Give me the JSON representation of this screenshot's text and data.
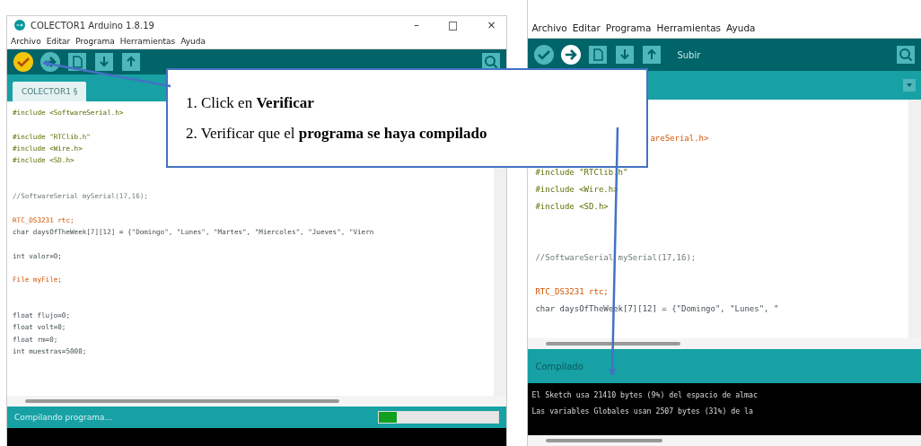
{
  "callout": {
    "steps": [
      "1. Click en **Verificar**",
      "2. Verificar que el **programa se haya compilado**"
    ]
  },
  "left_window": {
    "title": "COLECTOR1 Arduino 1.8.19",
    "window_controls": [
      "–",
      "□",
      "×"
    ],
    "menu": [
      "Archivo",
      "Editar",
      "Programa",
      "Herramientas",
      "Ayuda"
    ],
    "toolbar": [
      {
        "kind": "verify",
        "highlighted": true
      },
      {
        "kind": "upload",
        "highlighted": false
      },
      {
        "kind": "new",
        "highlighted": false
      },
      {
        "kind": "open",
        "highlighted": false
      },
      {
        "kind": "save",
        "highlighted": false
      }
    ],
    "tab": "COLECTOR1 §",
    "code": [
      {
        "kind": "directive",
        "text": "#include <SoftwareSerial.h>"
      },
      {
        "kind": "blank"
      },
      {
        "kind": "directive",
        "text": "#include \"RTClib.h\""
      },
      {
        "kind": "directive",
        "text": "#include <Wire.h>"
      },
      {
        "kind": "directive",
        "text": "#include <SD.h>"
      },
      {
        "kind": "blank"
      },
      {
        "kind": "blank"
      },
      {
        "kind": "comment",
        "text": "//SoftwareSerial mySerial(17,16);"
      },
      {
        "kind": "blank"
      },
      {
        "kind": "type",
        "text": "RTC_DS3231 rtc;"
      },
      {
        "kind": "code",
        "text": "char daysOfTheWeek[7][12] = {\"Domingo\", \"Lunes\", \"Martes\", \"Miercoles\", \"Jueves\", \"Viern"
      },
      {
        "kind": "blank"
      },
      {
        "kind": "code",
        "text": "int valor=0;"
      },
      {
        "kind": "blank"
      },
      {
        "kind": "type",
        "text": "File myFile;"
      },
      {
        "kind": "blank"
      },
      {
        "kind": "blank"
      },
      {
        "kind": "code",
        "text": "float flujo=0;"
      },
      {
        "kind": "code",
        "text": "float volt=0;"
      },
      {
        "kind": "code",
        "text": "float rm=0;"
      },
      {
        "kind": "code",
        "text": "int muestras=5000;"
      }
    ],
    "status": "Compilando programa...",
    "progress": {
      "level": 0.15
    }
  },
  "right_window": {
    "menu": [
      "Archivo",
      "Editar",
      "Programa",
      "Herramientas",
      "Ayuda"
    ],
    "toolbar": [
      {
        "kind": "verify",
        "highlighted": false
      },
      {
        "kind": "upload",
        "highlighted": true
      },
      {
        "kind": "new",
        "highlighted": false
      },
      {
        "kind": "open",
        "highlighted": false
      },
      {
        "kind": "save",
        "highlighted": false
      }
    ],
    "tooltip": "Subir",
    "code": [
      {
        "kind": "tail",
        "text": "areSerial.h>"
      },
      {
        "kind": "blank"
      },
      {
        "kind": "directive",
        "text": "#include \"RTClib.h\""
      },
      {
        "kind": "directive",
        "text": "#include <Wire.h>"
      },
      {
        "kind": "directive",
        "text": "#include <SD.h>"
      },
      {
        "kind": "blank"
      },
      {
        "kind": "blank"
      },
      {
        "kind": "comment",
        "text": "//SoftwareSerial mySerial(17,16);"
      },
      {
        "kind": "blank"
      },
      {
        "kind": "type",
        "text": "RTC_DS3231 rtc;"
      },
      {
        "kind": "code",
        "text": "char daysOfTheWeek[7][12] = {\"Domingo\", \"Lunes\", \""
      }
    ],
    "status": "Compilado",
    "console": [
      "El Sketch usa 21410 bytes (9%) del espacio de almac",
      "Las variables Globales usan 2507 bytes (31%) de la"
    ]
  }
}
